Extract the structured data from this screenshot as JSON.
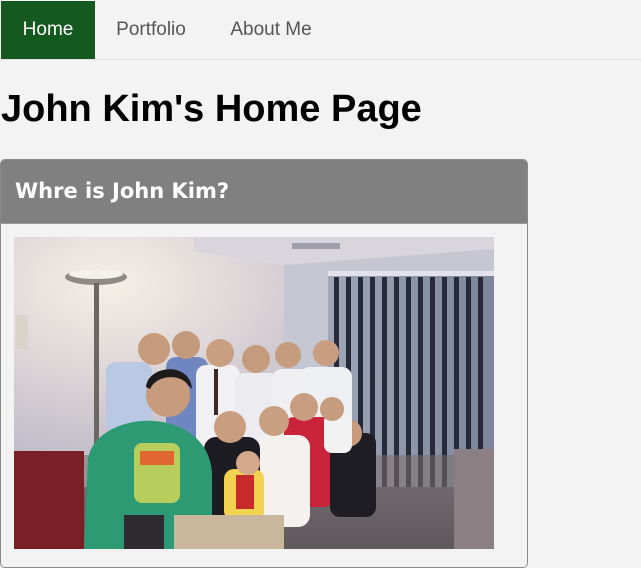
{
  "nav": {
    "items": [
      {
        "label": "Home",
        "active": true
      },
      {
        "label": "Portfolio",
        "active": false
      },
      {
        "label": "About Me",
        "active": false
      }
    ]
  },
  "page": {
    "title": "John Kim's Home Page"
  },
  "card": {
    "title": "Whre is John Kim?",
    "photo_icon": "group-photo-image"
  },
  "colors": {
    "nav_active_bg": "#14591f",
    "card_header_bg": "#808080",
    "page_bg": "#f3f3f3"
  }
}
